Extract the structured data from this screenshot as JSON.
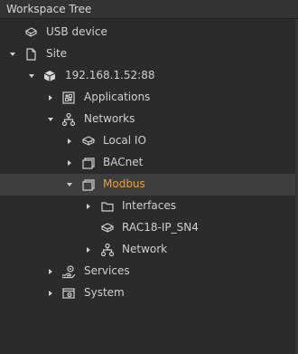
{
  "panel": {
    "title": "Workspace Tree"
  },
  "tree": {
    "usb": {
      "label": "USB device",
      "icon": "usb-drive-icon"
    },
    "site": {
      "label": "Site",
      "icon": "document-icon",
      "expanded": true
    },
    "device": {
      "label": "192.168.1.52:88",
      "icon": "device-cube-icon",
      "expanded": true
    },
    "applications": {
      "label": "Applications",
      "icon": "applications-icon",
      "expanded": false
    },
    "networks": {
      "label": "Networks",
      "icon": "network-icon",
      "expanded": true
    },
    "localio": {
      "label": "Local IO",
      "icon": "io-device-icon",
      "expanded": false
    },
    "bacnet": {
      "label": "BACnet",
      "icon": "bacnet-icon",
      "expanded": false
    },
    "modbus": {
      "label": "Modbus",
      "icon": "modbus-icon",
      "expanded": true,
      "selected": true
    },
    "interfaces": {
      "label": "Interfaces",
      "icon": "folder-icon",
      "expanded": false
    },
    "rac18": {
      "label": "RAC18-IP_SN4",
      "icon": "io-device-icon"
    },
    "network": {
      "label": "Network",
      "icon": "network-icon",
      "expanded": false
    },
    "services": {
      "label": "Services",
      "icon": "services-icon",
      "expanded": false
    },
    "system": {
      "label": "System",
      "icon": "system-icon",
      "expanded": false
    }
  },
  "colors": {
    "background": "#2b2b2b",
    "header": "#333333",
    "selected_row": "#3e3e3e",
    "text": "#d0d0d0",
    "selected_text": "#e6a23c"
  }
}
